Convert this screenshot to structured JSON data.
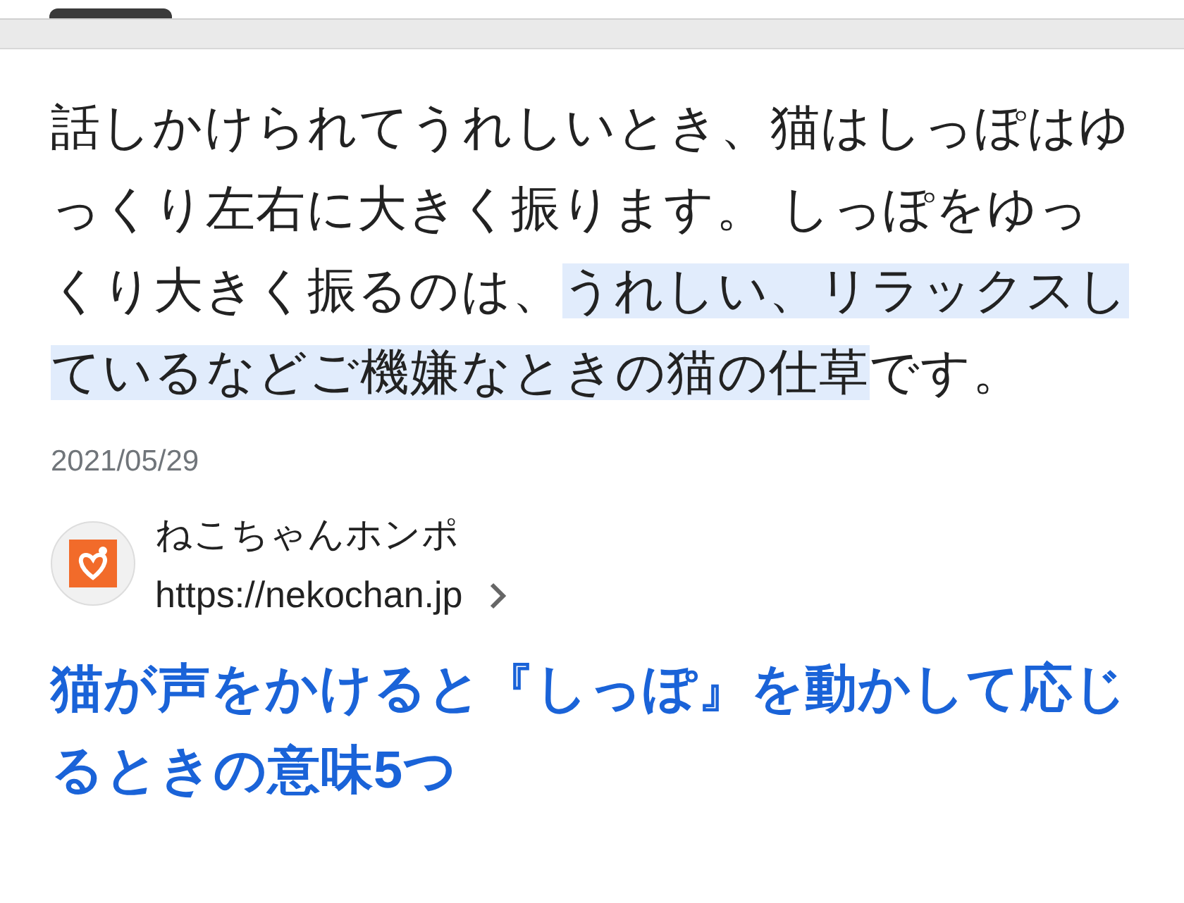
{
  "snippet": {
    "text_before": "話しかけられてうれしいとき、猫はしっぽはゆっくり左右に大きく振ります。 しっぽをゆっくり大きく振るのは、",
    "highlighted": "うれしい、リラックスしているなどご機嫌なときの猫の仕草",
    "text_after": "です。"
  },
  "date": "2021/05/29",
  "source": {
    "name": "ねこちゃんホンポ",
    "url": "https://nekochan.jp"
  },
  "result_title": "猫が声をかけると『しっぽ』を動かして応じるときの意味5つ"
}
